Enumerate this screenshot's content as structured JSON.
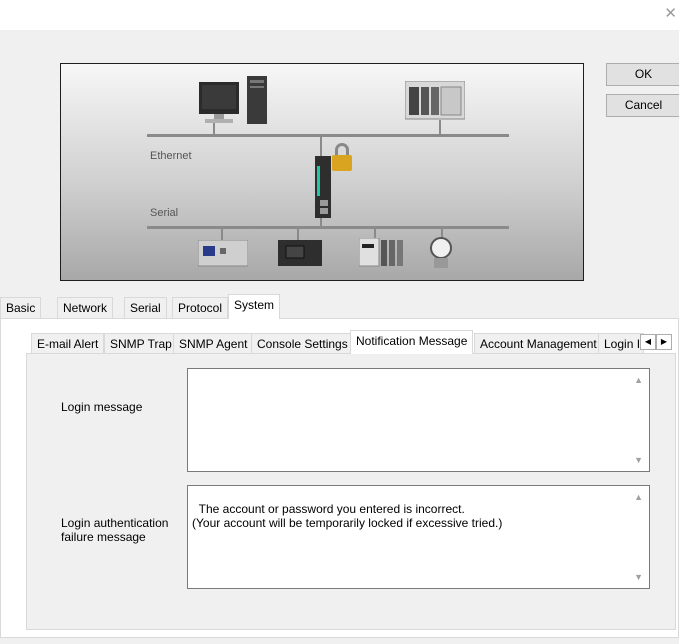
{
  "window": {
    "close_glyph": "✕"
  },
  "diagram": {
    "ethernet_label": "Ethernet",
    "serial_label": "Serial"
  },
  "buttons": {
    "ok": "OK",
    "cancel": "Cancel"
  },
  "outer_tabs": [
    {
      "label": "Basic"
    },
    {
      "label": "Network"
    },
    {
      "label": "Serial"
    },
    {
      "label": "Protocol"
    },
    {
      "label": "System",
      "active": true
    }
  ],
  "inner_tabs": [
    {
      "label": "E-mail Alert"
    },
    {
      "label": "SNMP Trap"
    },
    {
      "label": "SNMP Agent"
    },
    {
      "label": "Console Settings"
    },
    {
      "label": "Notification Message",
      "active": true
    },
    {
      "label": "Account Management"
    },
    {
      "label": "Login I"
    }
  ],
  "tab_scroll": {
    "left": "◀",
    "right": "▶"
  },
  "form": {
    "login_message_label": "Login message",
    "login_message_value": "",
    "failure_label": "Login authentication\nfailure message",
    "failure_value": "The account or password you entered is incorrect.\n(Your account will be temporarily locked if excessive tried.)"
  }
}
